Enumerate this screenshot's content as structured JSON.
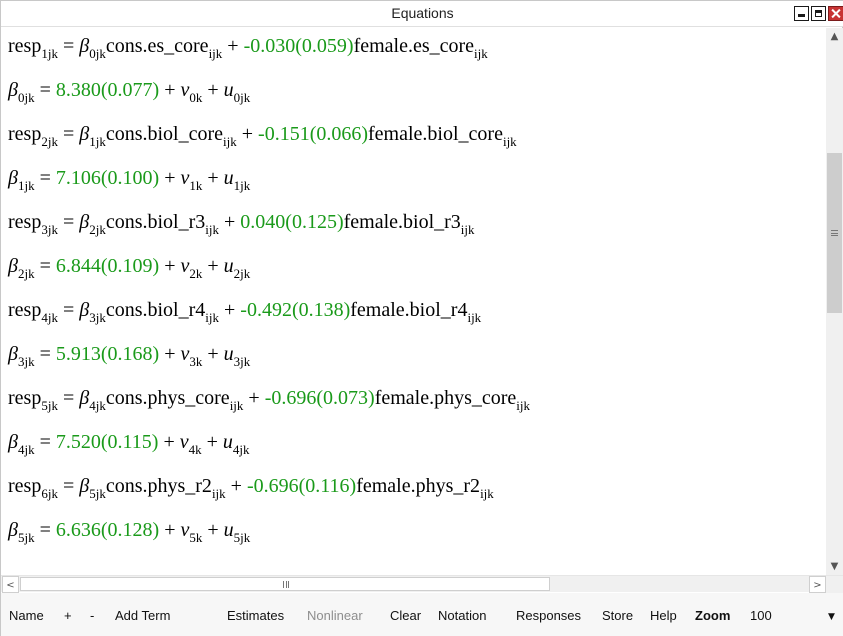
{
  "window": {
    "title": "Equations"
  },
  "equations": [
    {
      "lhs": "resp",
      "lhs_sub": "1jk",
      "beta": "β",
      "beta_sub": "0jk",
      "term": "cons.es_core",
      "term_sub": "ijk",
      "coef": "-0.030(0.059)",
      "var": "female.es_core",
      "var_sub": "ijk"
    },
    {
      "beta_sub": "0jk",
      "value": "8.380(0.077)",
      "v_sub": "0k",
      "u_sub": "0jk"
    },
    {
      "lhs": "resp",
      "lhs_sub": "2jk",
      "beta": "β",
      "beta_sub": "1jk",
      "term": "cons.biol_core",
      "term_sub": "ijk",
      "coef": "-0.151(0.066)",
      "var": "female.biol_core",
      "var_sub": "ijk"
    },
    {
      "beta_sub": "1jk",
      "value": "7.106(0.100)",
      "v_sub": "1k",
      "u_sub": "1jk"
    },
    {
      "lhs": "resp",
      "lhs_sub": "3jk",
      "beta": "β",
      "beta_sub": "2jk",
      "term": "cons.biol_r3",
      "term_sub": "ijk",
      "coef": "0.040(0.125)",
      "var": "female.biol_r3",
      "var_sub": "ijk"
    },
    {
      "beta_sub": "2jk",
      "value": "6.844(0.109)",
      "v_sub": "2k",
      "u_sub": "2jk"
    },
    {
      "lhs": "resp",
      "lhs_sub": "4jk",
      "beta": "β",
      "beta_sub": "3jk",
      "term": "cons.biol_r4",
      "term_sub": "ijk",
      "coef": "-0.492(0.138)",
      "var": "female.biol_r4",
      "var_sub": "ijk"
    },
    {
      "beta_sub": "3jk",
      "value": "5.913(0.168)",
      "v_sub": "3k",
      "u_sub": "3jk"
    },
    {
      "lhs": "resp",
      "lhs_sub": "5jk",
      "beta": "β",
      "beta_sub": "4jk",
      "term": "cons.phys_core",
      "term_sub": "ijk",
      "coef": "-0.696(0.073)",
      "var": "female.phys_core",
      "var_sub": "ijk"
    },
    {
      "beta_sub": "4jk",
      "value": "7.520(0.115)",
      "v_sub": "4k",
      "u_sub": "4jk"
    },
    {
      "lhs": "resp",
      "lhs_sub": "6jk",
      "beta": "β",
      "beta_sub": "5jk",
      "term": "cons.phys_r2",
      "term_sub": "ijk",
      "coef": "-0.696(0.116)",
      "var": "female.phys_r2",
      "var_sub": "ijk"
    },
    {
      "beta_sub": "5jk",
      "value": "6.636(0.128)",
      "v_sub": "5k",
      "u_sub": "5jk"
    }
  ],
  "symbols": {
    "eq": "=",
    "plus": "+",
    "v": "v",
    "u": "u",
    "beta": "β"
  },
  "toolbar": {
    "name": "Name",
    "plus": "+",
    "minus": "-",
    "add_term": "Add Term",
    "estimates": "Estimates",
    "nonlinear": "Nonlinear",
    "clear": "Clear",
    "notation": "Notation",
    "responses": "Responses",
    "store": "Store",
    "help": "Help",
    "zoom": "Zoom",
    "zoom_value": "100"
  },
  "icons": {
    "scroll_up": "▲",
    "scroll_down": "▼",
    "scroll_left": "<",
    "scroll_right": ">",
    "dropdown": "▼"
  },
  "colors": {
    "estimate_green": "#1a9a1a",
    "close_red": "#c83434"
  }
}
